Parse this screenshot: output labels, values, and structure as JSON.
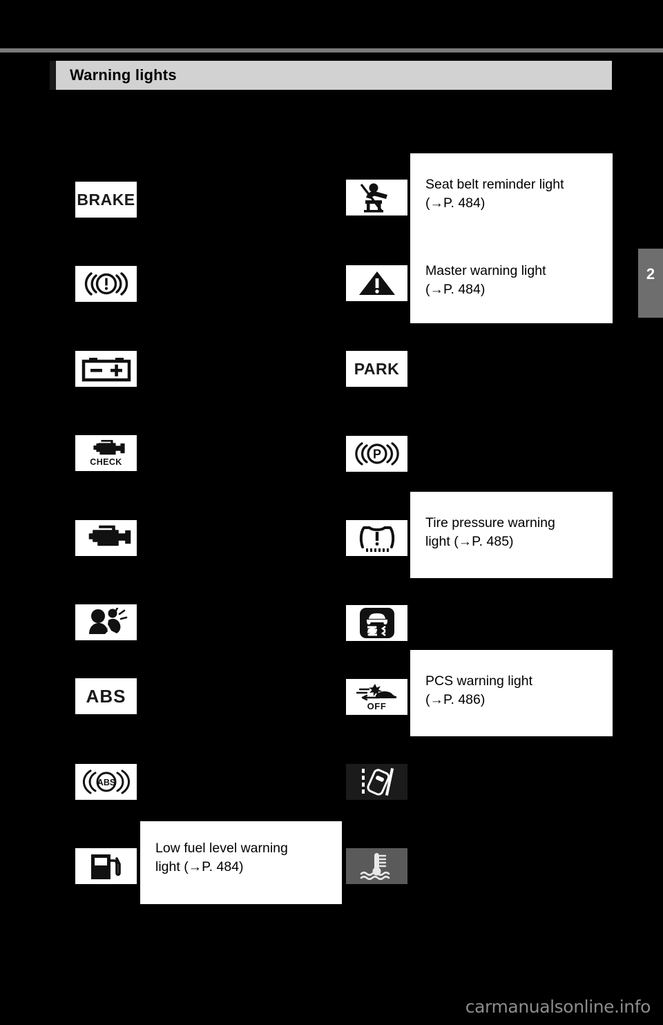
{
  "page": {
    "background_color": "#000000",
    "chapter_tab": "2",
    "footer_watermark": "carmanualsonline.info"
  },
  "header": {
    "title": "Warning lights",
    "bar_color": "#d2d2d2"
  },
  "columns": {
    "left": {
      "items": [
        {
          "icon_name": "brake-system-warning-icon",
          "icon_label": "BRAKE",
          "description": ""
        },
        {
          "icon_name": "brake-system-circle-warning-icon",
          "icon_label": "",
          "description": ""
        },
        {
          "icon_name": "charging-system-battery-warning-icon",
          "icon_label": "",
          "description": ""
        },
        {
          "icon_name": "engine-check-warning-icon",
          "icon_label": "CHECK",
          "description": ""
        },
        {
          "icon_name": "malfunction-indicator-engine-icon",
          "icon_label": "",
          "description": ""
        },
        {
          "icon_name": "srs-airbag-warning-icon",
          "icon_label": "",
          "description": ""
        },
        {
          "icon_name": "abs-warning-icon",
          "icon_label": "ABS",
          "description": ""
        },
        {
          "icon_name": "abs-circle-warning-icon",
          "icon_label": "ABS",
          "description": ""
        },
        {
          "icon_name": "low-fuel-level-warning-icon",
          "icon_label": "",
          "description": "Low fuel level warning light (→P. 484)"
        }
      ]
    },
    "right": {
      "items": [
        {
          "icon_name": "seat-belt-reminder-icon",
          "icon_label": "",
          "description": "Seat belt reminder light (→P. 484)"
        },
        {
          "icon_name": "master-warning-icon",
          "icon_label": "",
          "description": "Master warning light (→P. 484)"
        },
        {
          "icon_name": "park-warning-icon",
          "icon_label": "PARK",
          "description": ""
        },
        {
          "icon_name": "parking-brake-warning-icon",
          "icon_label": "",
          "description": ""
        },
        {
          "icon_name": "tire-pressure-warning-icon",
          "icon_label": "",
          "description": "Tire pressure warning light (→P. 485)"
        },
        {
          "icon_name": "vsc-skid-warning-icon",
          "icon_label": "",
          "description": ""
        },
        {
          "icon_name": "pcs-off-warning-icon",
          "icon_label": "OFF",
          "description": "PCS warning light (→P. 486)"
        },
        {
          "icon_name": "lane-departure-alert-icon",
          "icon_label": "",
          "description": ""
        },
        {
          "icon_name": "engine-coolant-temperature-icon",
          "icon_label": "",
          "description": ""
        }
      ]
    }
  },
  "callouts": {
    "seat_belt": {
      "line1": "Seat belt reminder light",
      "line2": "(→P. 484)"
    },
    "master_warning": {
      "line1": "Master warning light",
      "line2": "(→P. 484)"
    },
    "tire_pressure": {
      "line1": "Tire pressure warning",
      "line2": "light (→P. 485)"
    },
    "pcs": {
      "line1": "PCS warning light",
      "line2": "(→P. 486)"
    },
    "low_fuel": {
      "line1": "Low fuel level warning",
      "line2": "light (→P. 484)"
    }
  }
}
